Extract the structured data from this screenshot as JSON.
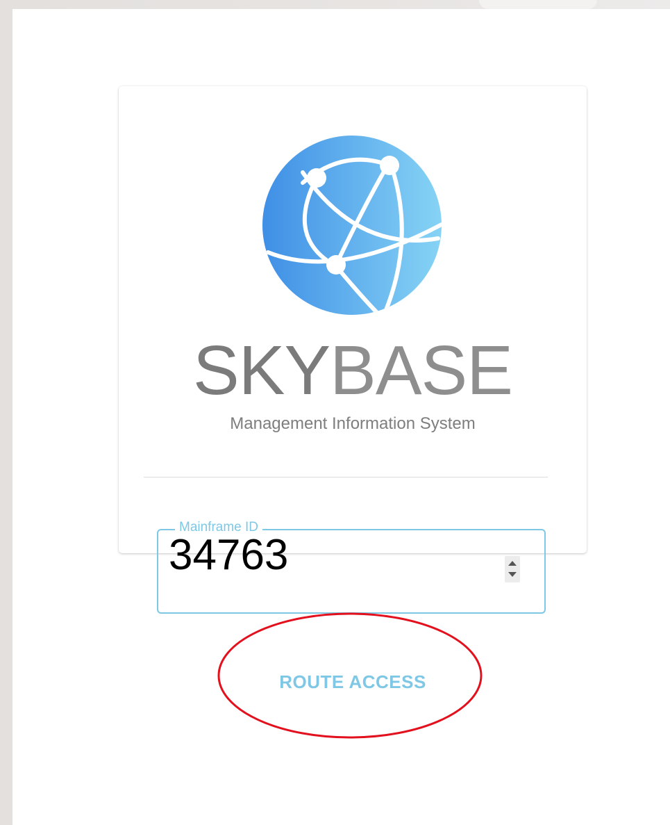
{
  "brand": {
    "name_light": "SKY",
    "name_bold": "BASE",
    "tagline": "Management Information System",
    "logo_icon": "globe-network-icon"
  },
  "form": {
    "field_label": "Mainframe ID",
    "field_value": "34763"
  },
  "actions": {
    "route_label": "ROUTE ACCESS"
  },
  "colors": {
    "accent": "#7ec8e6",
    "globe_dark": "#3f8fe6",
    "globe_light": "#7fd0f4",
    "brand_text": "#8a8a8a",
    "annotation": "#e3101d"
  }
}
